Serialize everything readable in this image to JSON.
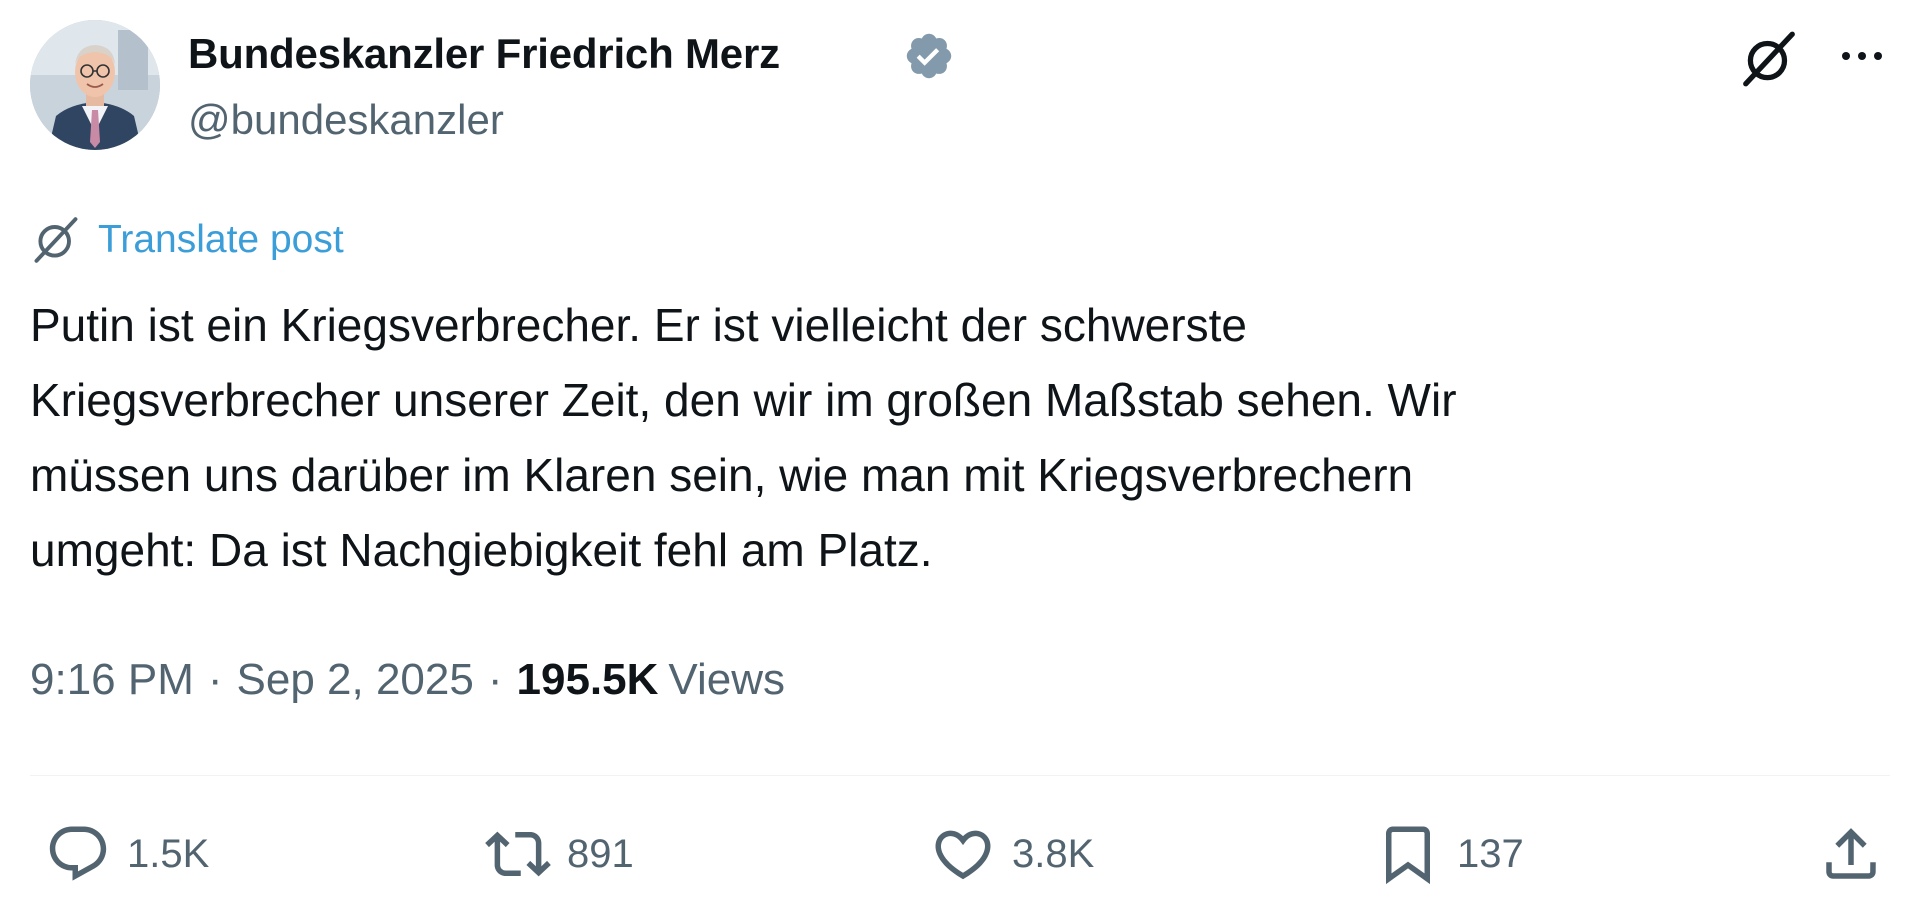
{
  "author": {
    "name": "Bundeskanzler Friedrich Merz",
    "handle": "@bundeskanzler",
    "verified_color": "#829aab"
  },
  "header_icons": {
    "grok": "grok-icon",
    "more": "more-icon"
  },
  "translate": {
    "label": "Translate post",
    "icon": "grok-icon",
    "color": "#3b9ed8"
  },
  "post": {
    "lines": [
      "Putin ist ein Kriegsverbrecher. Er ist vielleicht der schwerste",
      "Kriegsverbrecher unserer Zeit, den wir im großen Maßstab sehen. Wir",
      "müssen uns darüber im Klaren sein, wie man mit Kriegsverbrechern",
      "umgeht: Da ist Nachgiebigkeit fehl am Platz."
    ]
  },
  "meta": {
    "time": "9:16 PM",
    "separator": "·",
    "date": "Sep 2, 2025",
    "views_count": "195.5K",
    "views_label": "Views"
  },
  "actions": {
    "replies": "1.5K",
    "reposts": "891",
    "likes": "3.8K",
    "bookmarks": "137"
  },
  "colors": {
    "text_primary": "#0f1419",
    "text_secondary": "#536471",
    "link": "#3b9ed8",
    "divider": "#eff3f4"
  }
}
